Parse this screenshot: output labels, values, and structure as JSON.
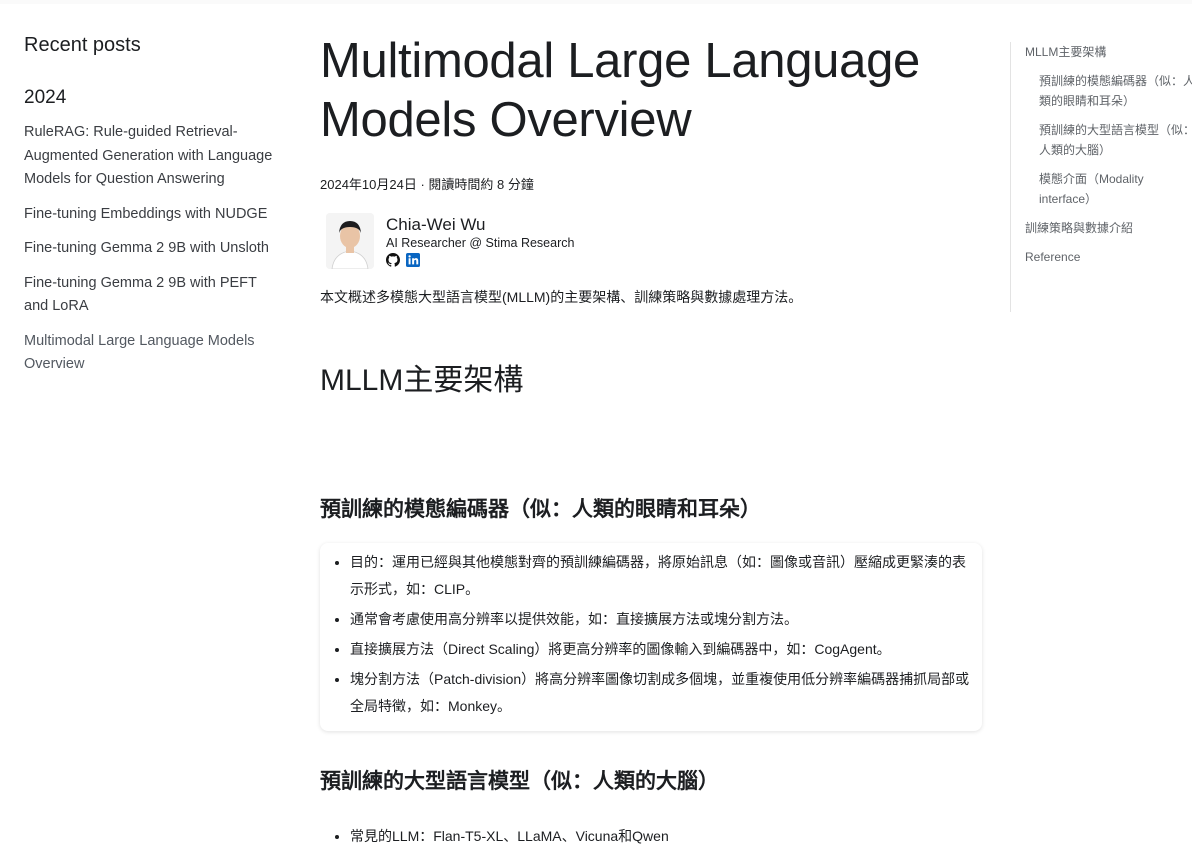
{
  "sidebar": {
    "title": "Recent posts",
    "year": "2024",
    "posts": [
      "RuleRAG: Rule-guided Retrieval-Augmented Generation with Language Models for Question Answering",
      "Fine-tuning Embeddings with NUDGE",
      "Fine-tuning Gemma 2 9B with Unsloth",
      "Fine-tuning Gemma 2 9B with PEFT and LoRA",
      "Multimodal Large Language Models Overview"
    ]
  },
  "article": {
    "title": "Multimodal Large Language Models Overview",
    "meta": "2024年10月24日 · 閱讀時間約 8 分鐘",
    "author": {
      "name": "Chia-Wei Wu",
      "role": "AI Researcher @ Stima Research",
      "socials": [
        "github-icon",
        "linkedin-icon"
      ]
    },
    "summary": "本文概述多模態大型語言模型(MLLM)的主要架構、訓練策略與數據處理方法。",
    "h2": "MLLM主要架構",
    "section1": {
      "heading": "預訓練的模態編碼器（似：人類的眼睛和耳朵）",
      "bullets": [
        "目的：運用已經與其他模態對齊的預訓練編碼器，將原始訊息（如：圖像或音訊）壓縮成更緊湊的表示形式，如：CLIP。",
        "通常會考慮使用高分辨率以提供效能，如：直接擴展方法或塊分割方法。",
        "直接擴展方法（Direct Scaling）將更高分辨率的圖像輸入到編碼器中，如：CogAgent。",
        "塊分割方法（Patch-division）將高分辨率圖像切割成多個塊，並重複使用低分辨率編碼器捕抓局部或全局特徵，如：Monkey。"
      ]
    },
    "section2": {
      "heading": "預訓練的大型語言模型（似：人類的大腦）",
      "bullets": [
        "常見的LLM：Flan-T5-XL、LLaMA、Vicuna和Qwen"
      ]
    }
  },
  "toc": {
    "items": [
      {
        "label": "MLLM主要架構",
        "level": 1
      },
      {
        "label": "預訓練的模態編碼器（似：人類的眼睛和耳朵）",
        "level": 2
      },
      {
        "label": "預訓練的大型語言模型（似：人類的大腦）",
        "level": 2
      },
      {
        "label": "模態介面（Modality interface）",
        "level": 2
      },
      {
        "label": "訓練策略與數據介紹",
        "level": 1
      },
      {
        "label": "Reference",
        "level": 1
      }
    ]
  }
}
